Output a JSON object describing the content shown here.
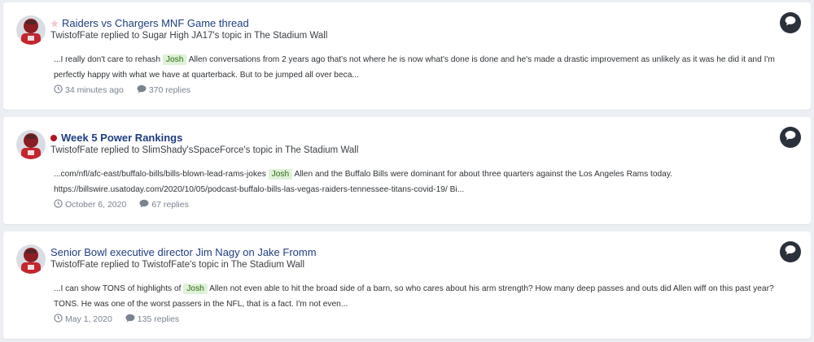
{
  "colors": {
    "background": "#ebeef2",
    "title_link": "#1e3d80",
    "highlight_bg": "#dff1d6",
    "highlight_text": "#2f6b1c",
    "hot_dot": "#b2131f",
    "muted": "#7a8390"
  },
  "results": [
    {
      "title": "Raiders vs Chargers MNF Game thread",
      "marker_icon": "star-icon",
      "author": "TwistofFate",
      "action": "replied to",
      "topic_owner": "Sugar High JA17's",
      "topic_word": "topic in",
      "forum": "The Stadium Wall",
      "snippet_before": "...I really don't care to rehash ",
      "highlight": "Josh",
      "snippet_after": " Allen conversations from 2 years ago that's not where he is now what's done is done and he's made a drastic improvement as unlikely as it was he did it and I'm perfectly happy with what we have at quarterback. But to be jumped all over beca...",
      "time": "34 minutes ago",
      "replies": "370 replies"
    },
    {
      "title": "Week 5 Power Rankings",
      "marker_icon": "hot-dot-icon",
      "author": "TwistofFate",
      "action": "replied to",
      "topic_owner": "SlimShady'sSpaceForce's",
      "topic_word": "topic in",
      "forum": "The Stadium Wall",
      "snippet_before": "...com/nfl/afc-east/buffalo-bills/bills-blown-lead-rams-jokes ",
      "highlight": "Josh",
      "snippet_after": " Allen and the Buffalo Bills were dominant for about three quarters against the Los Angeles Rams today. https://billswire.usatoday.com/2020/10/05/podcast-buffalo-bills-las-vegas-raiders-tennessee-titans-covid-19/ Bi...",
      "time": "October 6, 2020",
      "replies": "67 replies"
    },
    {
      "title": "Senior Bowl executive director Jim Nagy on Jake Fromm",
      "marker_icon": "",
      "author": "TwistofFate",
      "action": "replied to",
      "topic_owner": "TwistofFate's",
      "topic_word": "topic in",
      "forum": "The Stadium Wall",
      "snippet_before": "...I can show TONS of highlights of ",
      "highlight": "Josh",
      "snippet_after": " Allen not even able to hit the broad side of a barn, so who cares about his arm strength? How many deep passes and outs did Allen wiff on this past year? TONS. He was one of the worst passers in the NFL, that is a fact. I'm not even...",
      "time": "May 1, 2020",
      "replies": "135 replies"
    }
  ]
}
